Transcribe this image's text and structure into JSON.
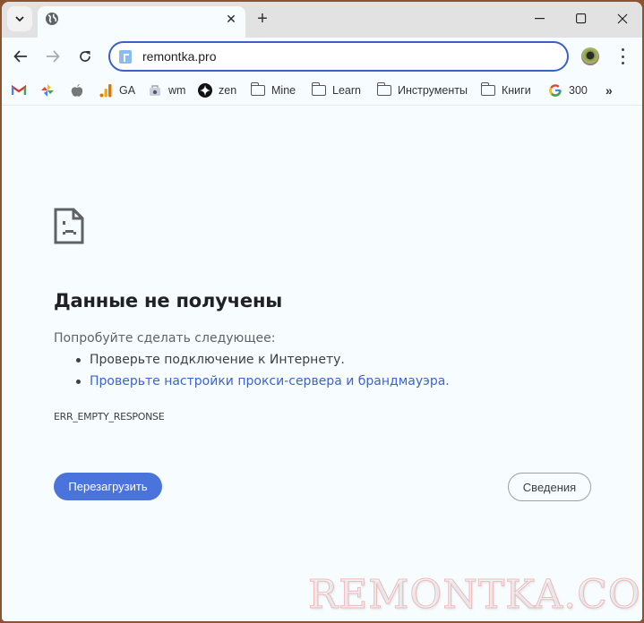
{
  "tabs": [
    {
      "title": "",
      "icon": "globe-icon",
      "active": true
    }
  ],
  "toolbar": {
    "url": "remontka.pro",
    "back_label": "Back",
    "forward_label": "Forward",
    "reload_label": "Reload"
  },
  "bookmarks": [
    {
      "label": "",
      "icon": "gmail-icon"
    },
    {
      "label": "",
      "icon": "pinwheel-icon"
    },
    {
      "label": "",
      "icon": "apple-icon"
    },
    {
      "label": "GA",
      "icon": "analytics-icon"
    },
    {
      "label": "wm",
      "icon": "webmaster-icon"
    },
    {
      "label": "zen",
      "icon": "zen-icon"
    },
    {
      "label": "Mine",
      "icon": "folder-icon"
    },
    {
      "label": "Learn",
      "icon": "folder-icon"
    },
    {
      "label": "Инструменты",
      "icon": "folder-icon"
    },
    {
      "label": "Книги",
      "icon": "folder-icon"
    },
    {
      "label": "300",
      "icon": "google-icon"
    }
  ],
  "error": {
    "title": "Данные не получены",
    "hint": "Попробуйте сделать следующее:",
    "suggestions": [
      "Проверьте подключение к Интернету.",
      "Проверьте настройки прокси-сервера и брандмауэра."
    ],
    "code": "ERR_EMPTY_RESPONSE",
    "reload_button": "Перезагрузить",
    "details_button": "Сведения"
  },
  "watermark": "REMONTKA.COM",
  "colors": {
    "accent": "#4a74dc",
    "link": "#3c63d2",
    "omnibox_border": "#3b5fc8"
  }
}
